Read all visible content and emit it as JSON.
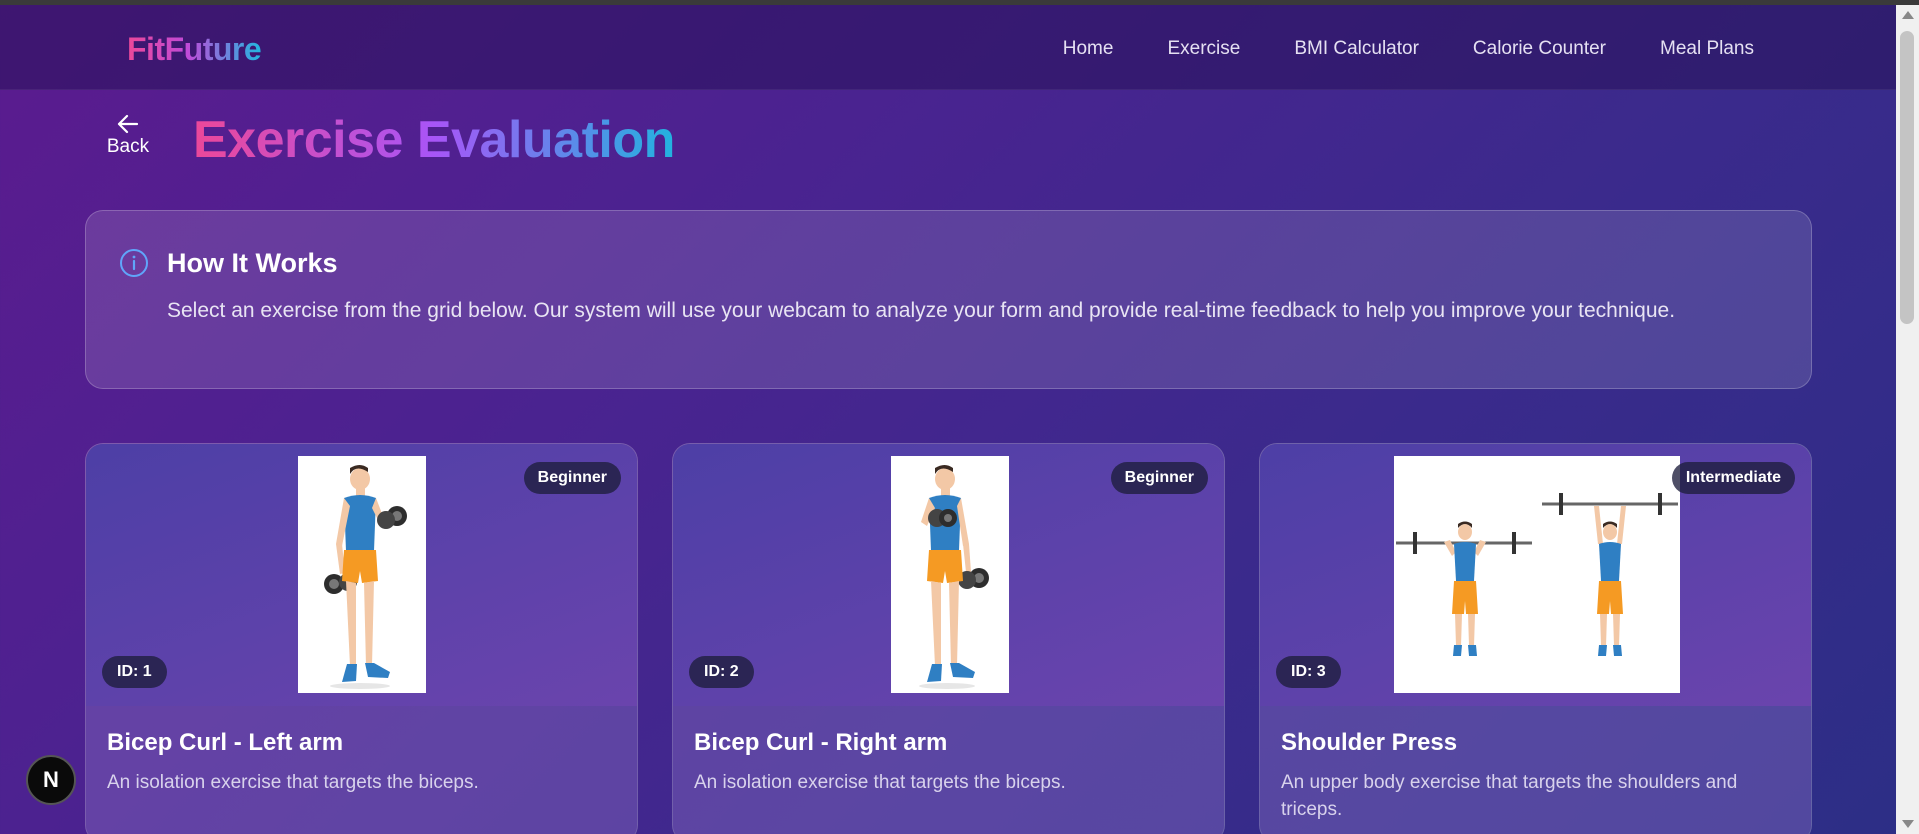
{
  "navbar": {
    "logo": "FitFuture",
    "links": [
      "Home",
      "Exercise",
      "BMI Calculator",
      "Calorie Counter",
      "Meal Plans"
    ]
  },
  "header": {
    "back_label": "Back",
    "title": "Exercise Evaluation"
  },
  "info": {
    "title": "How It Works",
    "text": "Select an exercise from the grid below. Our system will use your webcam to analyze your form and provide real-time feedback to help you improve your technique."
  },
  "cards": [
    {
      "level": "Beginner",
      "id_label": "ID: 1",
      "title": "Bicep Curl - Left arm",
      "description": "An isolation exercise that targets the biceps."
    },
    {
      "level": "Beginner",
      "id_label": "ID: 2",
      "title": "Bicep Curl - Right arm",
      "description": "An isolation exercise that targets the biceps."
    },
    {
      "level": "Intermediate",
      "id_label": "ID: 3",
      "title": "Shoulder Press",
      "description": "An upper body exercise that targets the shoulders and triceps."
    }
  ],
  "floating_button": {
    "label": "N"
  },
  "colors": {
    "accent_pink": "#ec4899",
    "accent_purple": "#a855f7",
    "accent_cyan": "#22b3df",
    "info_icon": "#60a5fa"
  }
}
